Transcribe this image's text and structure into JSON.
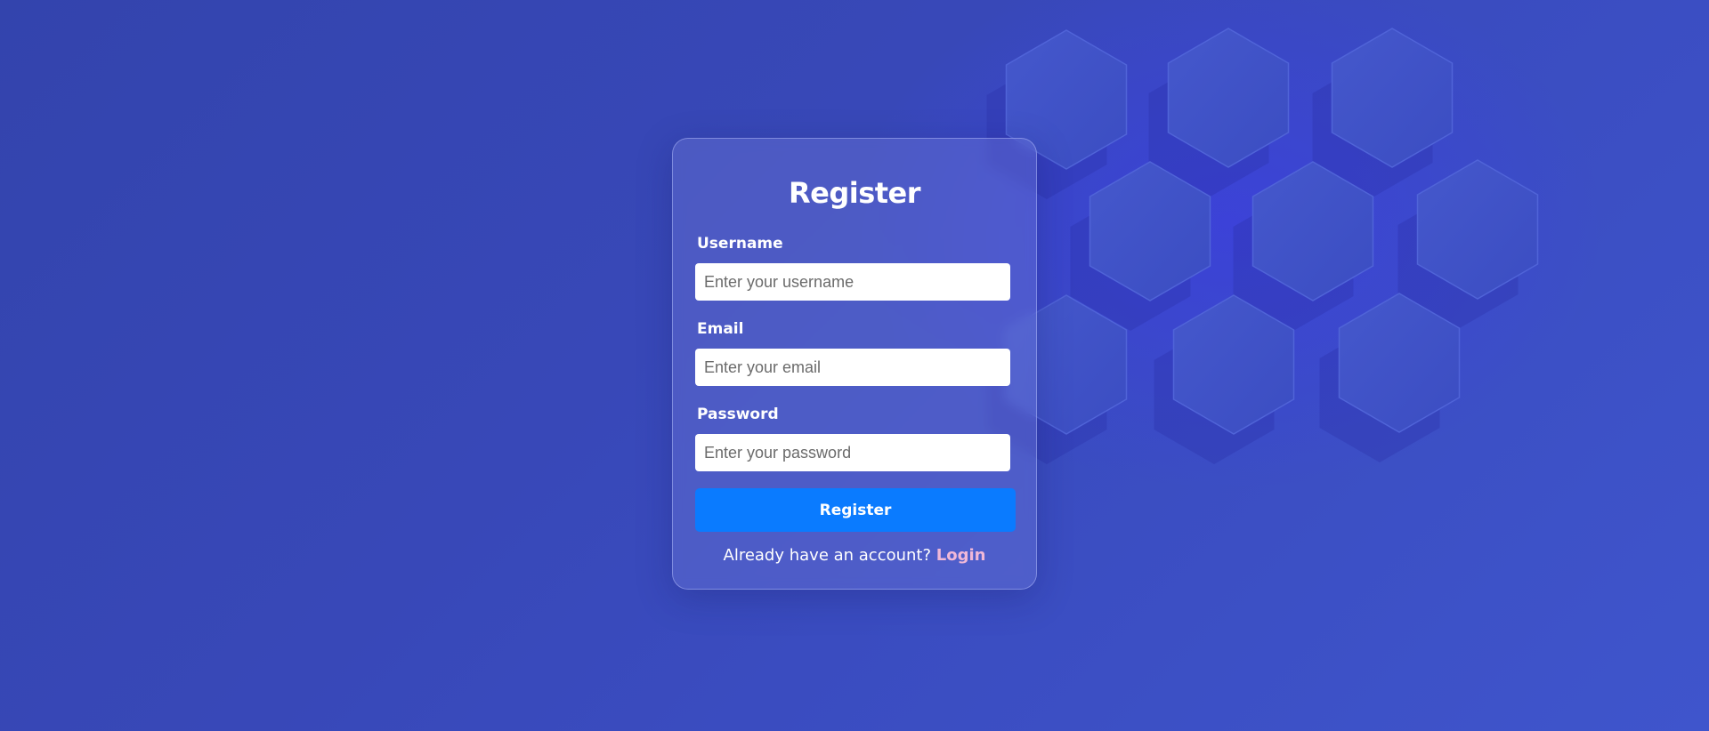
{
  "form": {
    "title": "Register",
    "fields": [
      {
        "label": "Username",
        "placeholder": "Enter your username",
        "value": ""
      },
      {
        "label": "Email",
        "placeholder": "Enter your email",
        "value": ""
      },
      {
        "label": "Password",
        "placeholder": "Enter your password",
        "value": ""
      }
    ],
    "submit_label": "Register",
    "footer_text": "Already have an account?",
    "footer_link": "Login"
  },
  "colors": {
    "background": "#3848b8",
    "button": "#0a7bff",
    "link": "#f0b8d8"
  },
  "icons": [
    "hexagon-pattern"
  ]
}
